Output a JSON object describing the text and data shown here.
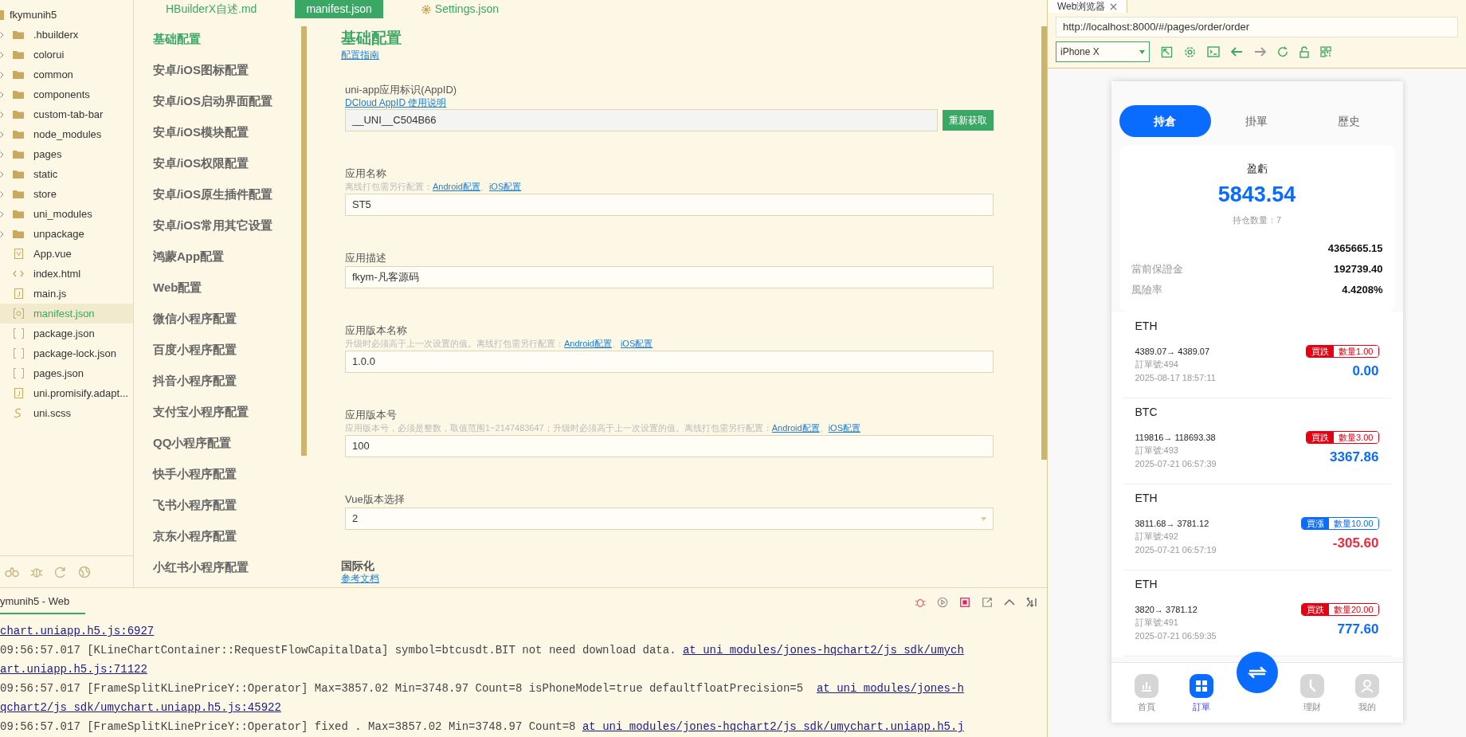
{
  "project": {
    "name": "fkymunih5",
    "items": [
      {
        "kind": "folder",
        "label": ".hbuilderx",
        "selected": false
      },
      {
        "kind": "folder",
        "label": "colorui",
        "selected": false
      },
      {
        "kind": "folder",
        "label": "common",
        "selected": false
      },
      {
        "kind": "folder",
        "label": "components",
        "selected": false
      },
      {
        "kind": "folder",
        "label": "custom-tab-bar",
        "selected": false
      },
      {
        "kind": "folder",
        "label": "node_modules",
        "selected": false
      },
      {
        "kind": "folder",
        "label": "pages",
        "selected": false
      },
      {
        "kind": "folder",
        "label": "static",
        "selected": false
      },
      {
        "kind": "folder",
        "label": "store",
        "selected": false
      },
      {
        "kind": "folder",
        "label": "uni_modules",
        "selected": false
      },
      {
        "kind": "folder",
        "label": "unpackage",
        "selected": false
      },
      {
        "kind": "vue",
        "label": "App.vue",
        "selected": false
      },
      {
        "kind": "html",
        "label": "index.html",
        "selected": false
      },
      {
        "kind": "js",
        "label": "main.js",
        "selected": false
      },
      {
        "kind": "config",
        "label": "manifest.json",
        "selected": true
      },
      {
        "kind": "json",
        "label": "package.json",
        "selected": false
      },
      {
        "kind": "json",
        "label": "package-lock.json",
        "selected": false
      },
      {
        "kind": "json",
        "label": "pages.json",
        "selected": false
      },
      {
        "kind": "js",
        "label": "uni.promisify.adapt...",
        "selected": false
      },
      {
        "kind": "style",
        "label": "uni.scss",
        "selected": false
      }
    ]
  },
  "editor_tabs": [
    {
      "label": "HBuilderX自述.md",
      "selected": false,
      "kind": "file"
    },
    {
      "label": "manifest.json",
      "selected": true,
      "kind": "file"
    },
    {
      "label": "Settings.json",
      "selected": false,
      "kind": "settings"
    }
  ],
  "settings_nav": [
    {
      "label": "基础配置",
      "selected": true
    },
    {
      "label": "安卓/iOS图标配置",
      "selected": false
    },
    {
      "label": "安卓/iOS启动界面配置",
      "selected": false
    },
    {
      "label": "安卓/iOS模块配置",
      "selected": false
    },
    {
      "label": "安卓/iOS权限配置",
      "selected": false
    },
    {
      "label": "安卓/iOS原生插件配置",
      "selected": false
    },
    {
      "label": "安卓/iOS常用其它设置",
      "selected": false
    },
    {
      "label": "鸿蒙App配置",
      "selected": false
    },
    {
      "label": "Web配置",
      "selected": false
    },
    {
      "label": "微信小程序配置",
      "selected": false
    },
    {
      "label": "百度小程序配置",
      "selected": false
    },
    {
      "label": "抖音小程序配置",
      "selected": false
    },
    {
      "label": "支付宝小程序配置",
      "selected": false
    },
    {
      "label": "QQ小程序配置",
      "selected": false
    },
    {
      "label": "快手小程序配置",
      "selected": false
    },
    {
      "label": "飞书小程序配置",
      "selected": false
    },
    {
      "label": "京东小程序配置",
      "selected": false
    },
    {
      "label": "小红书小程序配置",
      "selected": false
    }
  ],
  "form": {
    "title": "基础配置",
    "guide_link": "配置指南",
    "fields": [
      {
        "kind": "appid",
        "label": "uni-app应用标识(AppID)",
        "help_link": "DCloud AppID 使用说明",
        "value": "__UNI__C504B66",
        "button": "重新获取"
      },
      {
        "kind": "text",
        "label": "应用名称",
        "hint": "离线打包需另行配置：",
        "links": [
          "Android配置",
          "iOS配置"
        ],
        "separator": "、",
        "value": "ST5"
      },
      {
        "kind": "text",
        "label": "应用描述",
        "value": "fkym-凡客源码"
      },
      {
        "kind": "text",
        "label": "应用版本名称",
        "hint": "升级时必须高于上一次设置的值。离线打包需另行配置：",
        "links": [
          "Android配置",
          "iOS配置"
        ],
        "separator": "、",
        "value": "1.0.0"
      },
      {
        "kind": "text",
        "label": "应用版本号",
        "hint": "应用版本号，必须是整数，取值范围1~2147483647；升级时必须高于上一次设置的值。离线打包需另行配置：",
        "links": [
          "Android配置",
          "iOS配置"
        ],
        "separator": "、",
        "value": "100"
      },
      {
        "kind": "select",
        "label": "Vue版本选择",
        "value": "2"
      }
    ],
    "section": {
      "title": "国际化",
      "link": "参考文档"
    }
  },
  "console": {
    "tab": "ymunih5 - Web",
    "lines": [
      {
        "link": "chart.uniapp.h5.js:6927"
      },
      {
        "text": "09:56:57.017 [KLineChartContainer::RequestFlowCapitalData] symbol=btcusdt.BIT not need download data.",
        "link": "at uni_modules/jones-hqchart2/js_sdk/umych"
      },
      {
        "link": "art.uniapp.h5.js:71122"
      },
      {
        "text": "09:56:57.017 [FrameSplitKLinePriceY::Operator] Max=3857.02 Min=3748.97 Count=8 isPhoneModel=true defaultfloatPrecision=5 ",
        "link": "at uni_modules/jones-h"
      },
      {
        "link": "qchart2/js_sdk/umychart.uniapp.h5.js:45922"
      },
      {
        "text": "09:56:57.017 [FrameSplitKLinePriceY::Operator] fixed . Max=3857.02 Min=3748.97 Count=8",
        "link": "at uni_modules/jones-hqchart2/js_sdk/umychart.uniapp.h5.j"
      }
    ]
  },
  "browser": {
    "tab": "Web浏览器",
    "url": "http://localhost:8000/#/pages/order/order",
    "device": "iPhone X"
  },
  "phone": {
    "tabs": [
      {
        "label": "持倉",
        "selected": true
      },
      {
        "label": "掛單",
        "selected": false
      },
      {
        "label": "歷史",
        "selected": false
      }
    ],
    "summary": {
      "label": "盈虧",
      "value": "5843.54",
      "count": "持仓数量：7",
      "rows": [
        {
          "value": "4365665.15"
        },
        {
          "label": "當前保證金",
          "value": "192739.40"
        },
        {
          "label": "風險率",
          "value": "4.4208%"
        }
      ]
    },
    "orders": [
      {
        "symbol": "ETH",
        "prices": "4389.07→ 4389.07",
        "order_no": "訂單號:494",
        "time": "2025-08-17 18:57:11",
        "badge": {
          "side": "買跌",
          "qty": "數量1.00",
          "color": "#e60012"
        },
        "pnl": {
          "value": "0.00",
          "color": "#0a6cff"
        }
      },
      {
        "symbol": "BTC",
        "prices": "119816→ 118693.38",
        "order_no": "訂單號:493",
        "time": "2025-07-21 06:57:39",
        "badge": {
          "side": "買跌",
          "qty": "數量3.00",
          "color": "#e60012"
        },
        "pnl": {
          "value": "3367.86",
          "color": "#0a6cff"
        }
      },
      {
        "symbol": "ETH",
        "prices": "3811.68→ 3781.12",
        "order_no": "訂單號:492",
        "time": "2025-07-21 06:57:19",
        "badge": {
          "side": "買漲",
          "qty": "數量10.00",
          "color": "#0a6cff"
        },
        "pnl": {
          "value": "-305.60",
          "color": "#ee2a3c"
        }
      },
      {
        "symbol": "ETH",
        "prices": "3820→ 3781.12",
        "order_no": "訂單號:491",
        "time": "2025-07-21 06:59:35",
        "badge": {
          "side": "買跌",
          "qty": "數量20.00",
          "color": "#e60012"
        },
        "pnl": {
          "value": "777.60",
          "color": "#0a6cff"
        }
      }
    ],
    "nav": [
      {
        "kind": "home",
        "label": "首頁",
        "selected": false
      },
      {
        "kind": "orders",
        "label": "訂單",
        "selected": true
      },
      {
        "kind": "swap",
        "selected": false
      },
      {
        "kind": "finance",
        "label": "理財",
        "selected": false
      },
      {
        "kind": "profile",
        "label": "我的",
        "selected": false
      }
    ]
  }
}
